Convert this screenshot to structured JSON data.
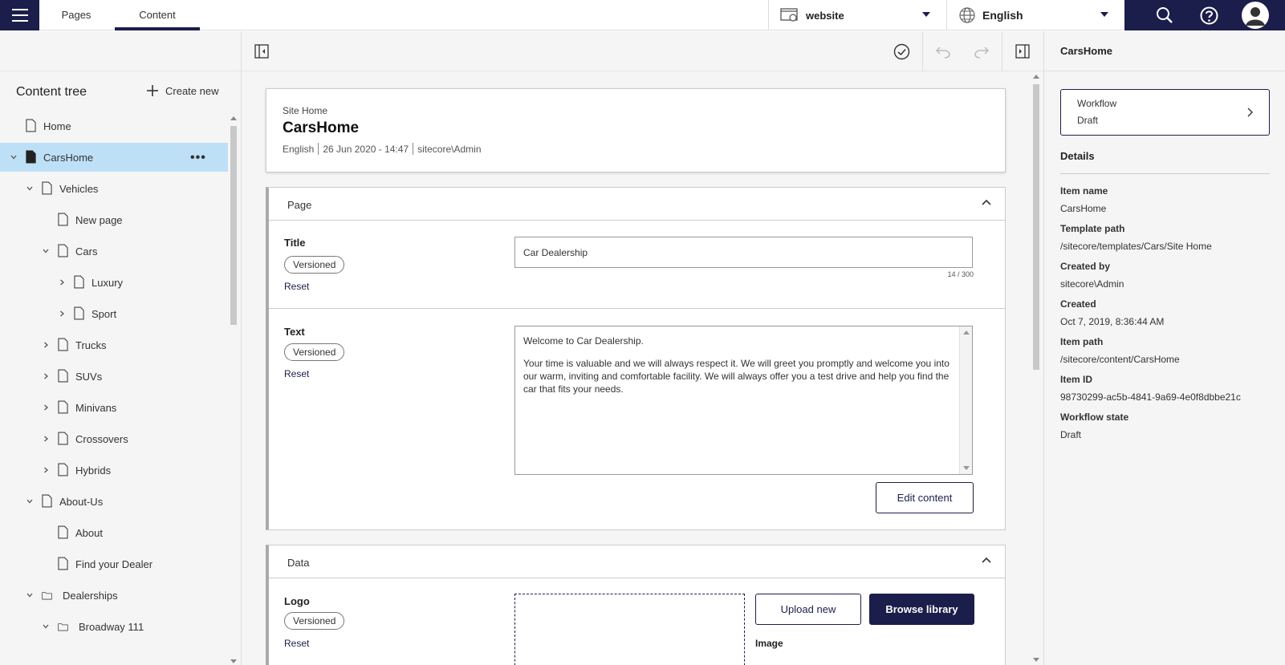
{
  "topbar": {
    "tabs": [
      {
        "label": "Pages"
      },
      {
        "label": "Content"
      }
    ],
    "site": "website",
    "language": "English"
  },
  "sidebar": {
    "title": "Content tree",
    "create_new": "Create new",
    "tree": [
      {
        "label": "Home"
      },
      {
        "label": "CarsHome"
      },
      {
        "label": "Vehicles"
      },
      {
        "label": "New page"
      },
      {
        "label": "Cars"
      },
      {
        "label": "Luxury"
      },
      {
        "label": "Sport"
      },
      {
        "label": "Trucks"
      },
      {
        "label": "SUVs"
      },
      {
        "label": "Minivans"
      },
      {
        "label": "Crossovers"
      },
      {
        "label": "Hybrids"
      },
      {
        "label": "About-Us"
      },
      {
        "label": "About"
      },
      {
        "label": "Find your Dealer"
      },
      {
        "label": "Dealerships"
      },
      {
        "label": "Broadway 111"
      }
    ]
  },
  "header": {
    "template": "Site Home",
    "name": "CarsHome",
    "language": "English",
    "date": "26 Jun 2020 - 14:47",
    "user": "sitecore\\Admin"
  },
  "page_section": {
    "title": "Page",
    "title_field": {
      "label": "Title",
      "versioned": "Versioned",
      "reset": "Reset",
      "value": "Car Dealership",
      "counter": "14 / 300"
    },
    "text_field": {
      "label": "Text",
      "versioned": "Versioned",
      "reset": "Reset",
      "line1": "Welcome to Car Dealership.",
      "line2": "Your time is valuable and we will always respect it. We will greet you promptly and welcome you into our warm, inviting and comfortable facility. We will always offer you a test drive and help you find the car that fits your needs.",
      "edit_button": "Edit content"
    }
  },
  "data_section": {
    "title": "Data",
    "logo_field": {
      "label": "Logo",
      "versioned": "Versioned",
      "reset": "Reset",
      "upload": "Upload new",
      "browse": "Browse library",
      "image_label": "Image"
    }
  },
  "rpanel": {
    "title": "CarsHome",
    "workflow_label": "Workflow",
    "workflow_value": "Draft",
    "details_title": "Details",
    "details": [
      {
        "label": "Item name",
        "value": "CarsHome"
      },
      {
        "label": "Template path",
        "value": "/sitecore/templates/Cars/Site Home"
      },
      {
        "label": "Created by",
        "value": "sitecore\\Admin"
      },
      {
        "label": "Created",
        "value": "Oct 7, 2019, 8:36:44 AM"
      },
      {
        "label": "Item path",
        "value": "/sitecore/content/CarsHome"
      },
      {
        "label": "Item ID",
        "value": "98730299-ac5b-4841-9a69-4e0f8dbbe21c"
      },
      {
        "label": "Workflow state",
        "value": "Draft"
      }
    ]
  },
  "colors": {
    "brand": "#1b1e4b",
    "selected_row": "#bde0f7"
  }
}
